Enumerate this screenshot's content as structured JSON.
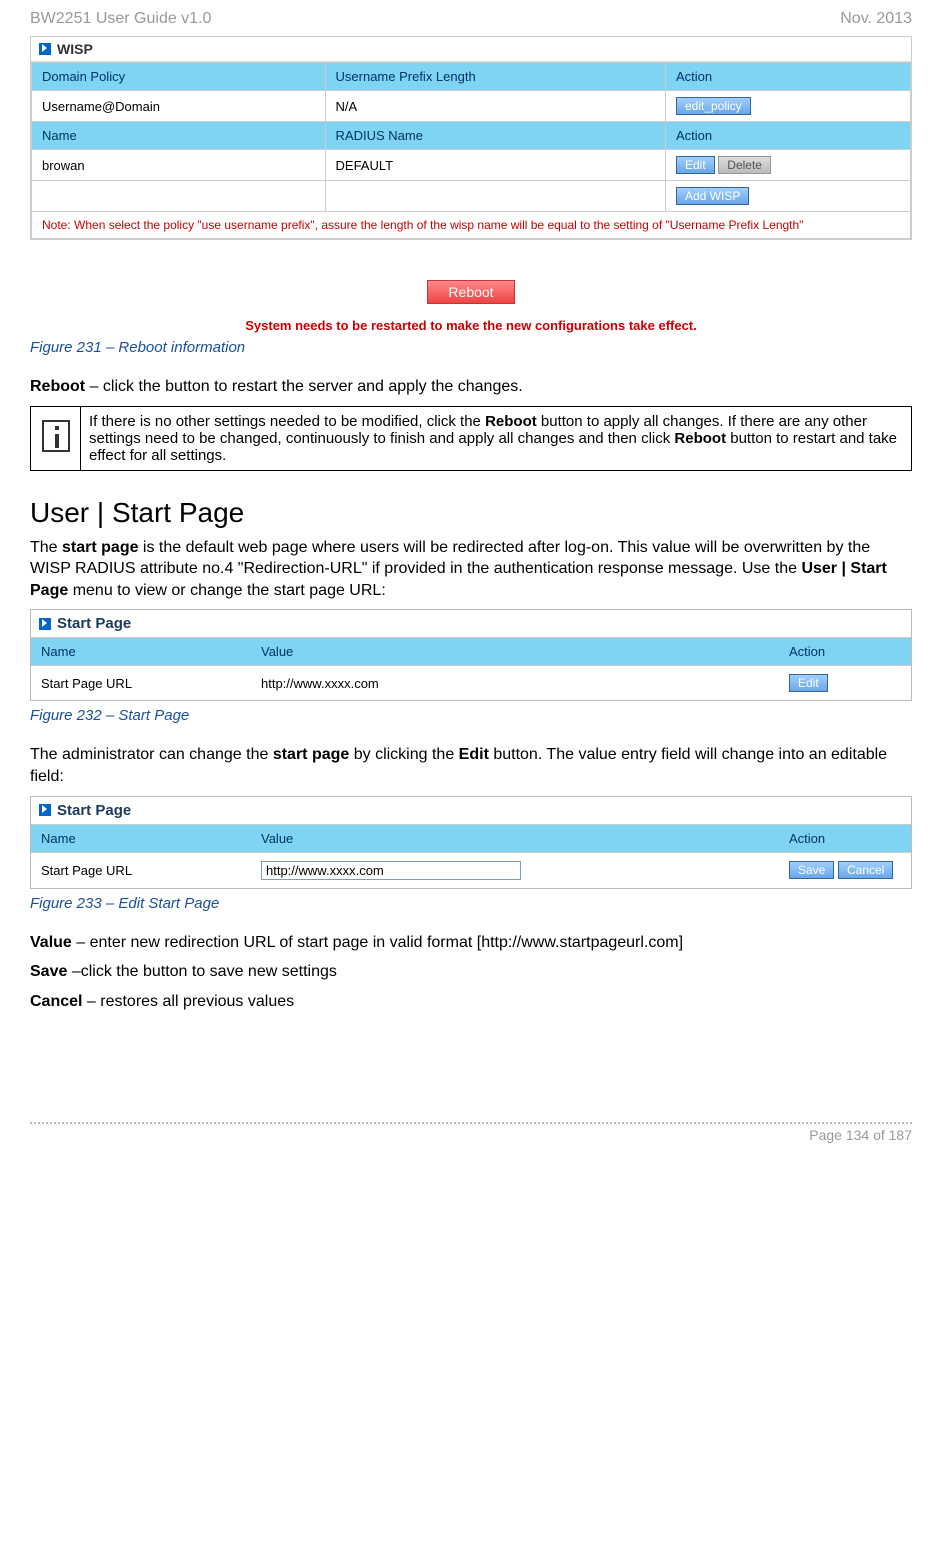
{
  "header": {
    "left": "BW2251 User Guide v1.0",
    "right": "Nov.  2013"
  },
  "wisp": {
    "title": "WISP",
    "cols1": [
      "Domain Policy",
      "Username Prefix Length",
      "Action"
    ],
    "row1": [
      "Username@Domain",
      "N/A"
    ],
    "edit_policy": "edit_policy",
    "cols2": [
      "Name",
      "RADIUS Name",
      "Action"
    ],
    "row2": [
      "browan",
      "DEFAULT"
    ],
    "edit": "Edit",
    "delete": "Delete",
    "add_wisp": "Add WISP",
    "note": "Note: When select the policy \"use username prefix\", assure the length of the wisp name will be equal to the setting of \"Username Prefix Length\"",
    "reboot": "Reboot",
    "reboot_msg": "System needs to be restarted to make the new configurations take effect."
  },
  "fig231": "Figure 231 – Reboot information",
  "reboot_line": {
    "bold": "Reboot",
    "rest": " – click the button to restart the server and apply the changes."
  },
  "info": {
    "p1a": "If there is no other settings needed to be modified, click the ",
    "p1b": "Reboot",
    "p1c": " button to apply all changes. If there are any other settings need to be changed, continuously to finish and apply all changes and then click ",
    "p1d": "Reboot",
    "p1e": " button to restart and take effect  for all settings."
  },
  "section": "User | Start Page",
  "intro": {
    "a": "The ",
    "b": "start page",
    "c": " is the default web page where users will be redirected after log-on. This value will be overwritten by the WISP RADIUS attribute no.4 \"Redirection-URL\" if provided in the authentication response message. Use the ",
    "d": "User | Start Page",
    "e": " menu to view or change the start page URL:"
  },
  "sp": {
    "title": "Start Page",
    "cols": [
      "Name",
      "Value",
      "Action"
    ],
    "row": [
      "Start Page URL",
      "http://www.xxxx.com"
    ],
    "edit": "Edit",
    "save": "Save",
    "cancel": "Cancel"
  },
  "fig232": "Figure 232 – Start Page",
  "edit_intro": {
    "a": "The administrator can change the ",
    "b": "start page",
    "c": " by clicking the ",
    "d": "Edit",
    "e": " button. The value entry field will change into an editable field:"
  },
  "fig233": "Figure 233 – Edit Start Page",
  "value_line": {
    "bold": "Value",
    "rest": " – enter new redirection URL of start page in valid format [http://www.startpageurl.com]"
  },
  "save_line": {
    "bold": "Save",
    "rest": " –click the button to save new settings"
  },
  "cancel_line": {
    "bold": "Cancel",
    "rest": " – restores all previous values"
  },
  "footer": "Page 134 of 187"
}
